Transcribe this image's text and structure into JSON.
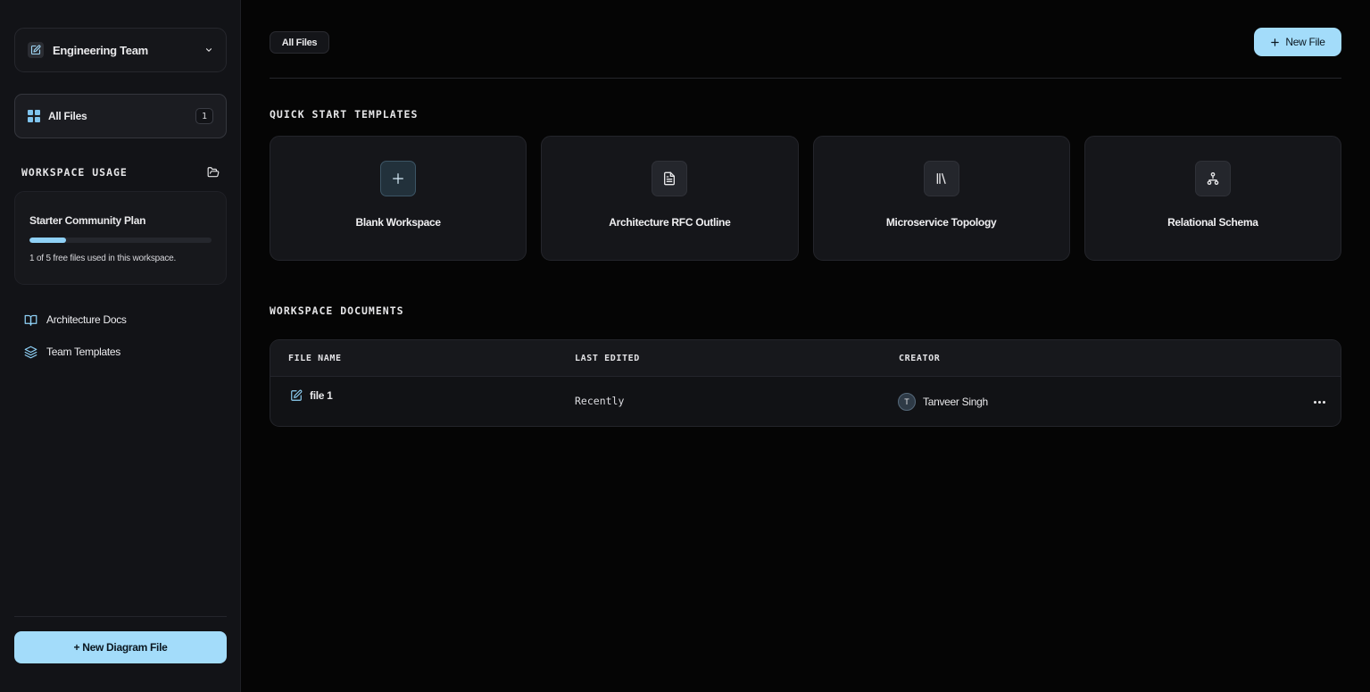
{
  "sidebar": {
    "team_name": "Engineering Team",
    "nav_all_files": {
      "label": "All Files",
      "count": "1"
    },
    "usage": {
      "title": "WORKSPACE USAGE",
      "plan_name": "Starter Community Plan",
      "progress_fraction": 0.2,
      "note": "1 of 5 free files used in this workspace."
    },
    "links": [
      {
        "label": "Architecture Docs",
        "icon": "book-open-icon"
      },
      {
        "label": "Team Templates",
        "icon": "layers-icon"
      }
    ],
    "new_diagram_label": "+ New Diagram File"
  },
  "header": {
    "tab_label": "All Files",
    "new_file_label": "New File"
  },
  "templates": {
    "title": "QUICK START TEMPLATES",
    "items": [
      {
        "label": "Blank Workspace",
        "icon": "plus-icon"
      },
      {
        "label": "Architecture RFC Outline",
        "icon": "document-icon"
      },
      {
        "label": "Microservice Topology",
        "icon": "library-icon"
      },
      {
        "label": "Relational Schema",
        "icon": "network-icon"
      }
    ]
  },
  "documents": {
    "title": "WORKSPACE DOCUMENTS",
    "columns": [
      "FILE NAME",
      "LAST EDITED",
      "CREATOR"
    ],
    "rows": [
      {
        "file_name": "file 1",
        "last_edited": "Recently",
        "creator_initial": "T",
        "creator": "Tanveer Singh"
      }
    ]
  },
  "colors": {
    "accent": "#a3dcfa",
    "background": "#050505",
    "sidebar": "#121317"
  }
}
